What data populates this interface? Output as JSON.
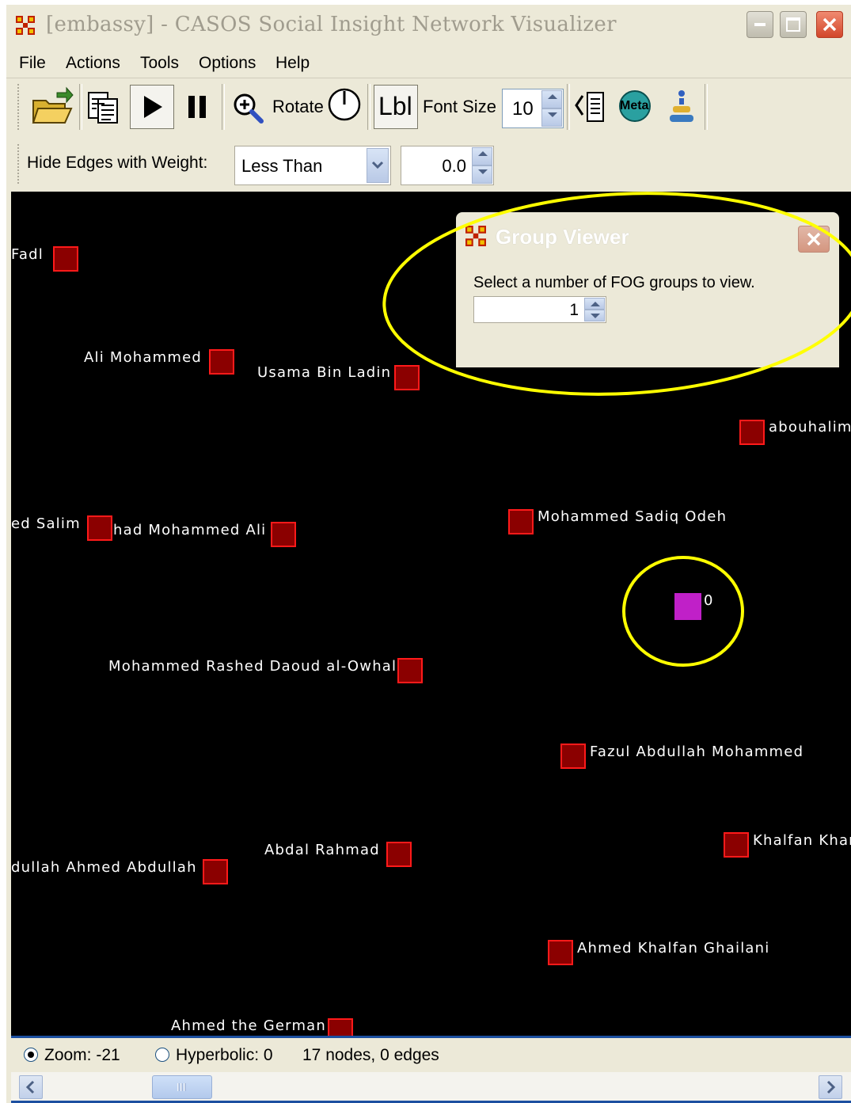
{
  "window": {
    "title": "[embassy] - CASOS Social Insight Network Visualizer"
  },
  "menu": [
    "File",
    "Actions",
    "Tools",
    "Options",
    "Help"
  ],
  "toolbar": {
    "rotate_label": "Rotate",
    "lbl_button": "Lbl",
    "font_size_label": "Font Size",
    "font_size_value": "10",
    "meta_label": "Meta"
  },
  "filter": {
    "label": "Hide Edges with Weight:",
    "operator": "Less Than",
    "value": "0.0"
  },
  "group_viewer": {
    "title": "Group Viewer",
    "message": "Select a number of FOG groups to view.",
    "count": "1"
  },
  "nodes": [
    {
      "label": "Fadl"
    },
    {
      "label": "Ali Mohammed"
    },
    {
      "label": "Usama Bin Ladin"
    },
    {
      "label": "abouhalim"
    },
    {
      "label": "ed Salim"
    },
    {
      "label": "had Mohammed Ali"
    },
    {
      "label": "Mohammed Sadiq Odeh"
    },
    {
      "label": "0"
    },
    {
      "label": "Mohammed Rashed Daoud al-Owhali"
    },
    {
      "label": "Fazul Abdullah Mohammed"
    },
    {
      "label": "Abdal Rahmad"
    },
    {
      "label": "dullah Ahmed Abdullah"
    },
    {
      "label": "Khalfan Khan"
    },
    {
      "label": "Ahmed Khalfan Ghailani"
    },
    {
      "label": "Ahmed the German"
    }
  ],
  "colors": {
    "node_fill": "#8b0000",
    "node_border": "#ff1a1a",
    "group_node": "#c020c8",
    "highlight_circle": "#ffff00",
    "canvas": "#000000"
  },
  "status": {
    "zoom_label": "Zoom: -21",
    "zoom_selected": true,
    "hyperbolic_label": "Hyperbolic: 0",
    "summary": "17 nodes, 0 edges"
  }
}
